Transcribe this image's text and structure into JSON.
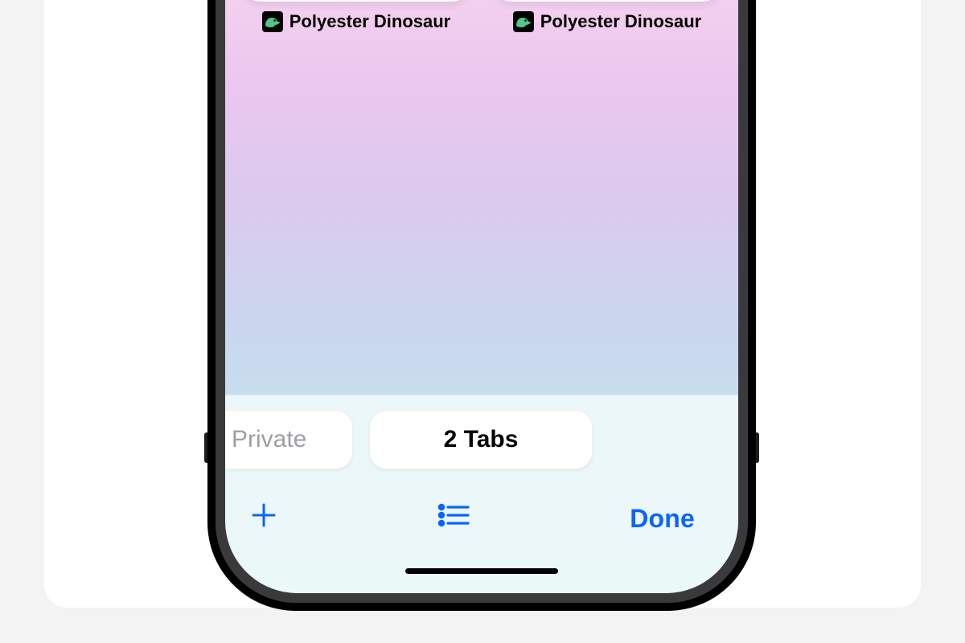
{
  "tabs": [
    {
      "title": "Polyester Dinosaur"
    },
    {
      "title": "Polyester Dinosaur"
    }
  ],
  "tab_group_pills": {
    "private_label": "Private",
    "active_label": "2 Tabs"
  },
  "toolbar": {
    "new_tab_icon": "plus",
    "list_icon": "list-bullet",
    "done_label": "Done"
  },
  "colors": {
    "ios_blue": "#0a64ff"
  }
}
